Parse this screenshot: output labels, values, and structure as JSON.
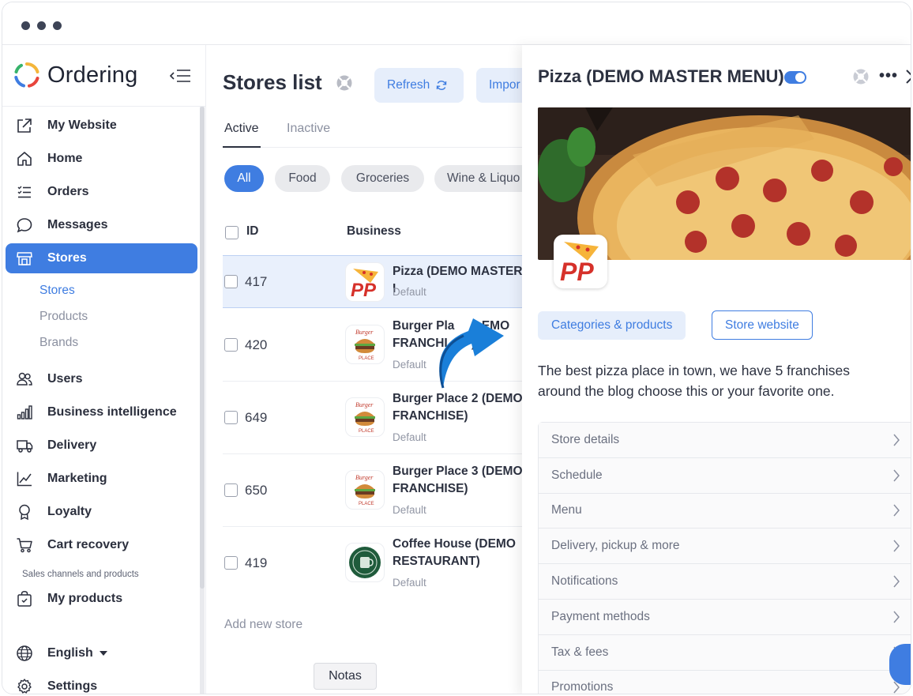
{
  "brand": {
    "name": "Ordering"
  },
  "sidebar": {
    "items": [
      {
        "label": "My Website",
        "icon": "external-link-icon"
      },
      {
        "label": "Home",
        "icon": "home-icon"
      },
      {
        "label": "Orders",
        "icon": "list-icon"
      },
      {
        "label": "Messages",
        "icon": "chat-icon"
      },
      {
        "label": "Stores",
        "icon": "store-icon",
        "active": true
      },
      {
        "label": "Users",
        "icon": "users-icon"
      },
      {
        "label": "Business intelligence",
        "icon": "bar-chart-icon"
      },
      {
        "label": "Delivery",
        "icon": "truck-icon"
      },
      {
        "label": "Marketing",
        "icon": "line-chart-icon"
      },
      {
        "label": "Loyalty",
        "icon": "award-icon"
      },
      {
        "label": "Cart recovery",
        "icon": "cart-icon"
      },
      {
        "label": "My products",
        "icon": "bag-icon"
      },
      {
        "label": "English",
        "icon": "globe-icon"
      },
      {
        "label": "Settings",
        "icon": "gear-icon"
      }
    ],
    "sub_items": [
      "Stores",
      "Products",
      "Brands"
    ],
    "section_caption": "Sales channels and products"
  },
  "main": {
    "title": "Stores list",
    "refresh_label": "Refresh",
    "import_label": "Impor",
    "tabs": [
      "Active",
      "Inactive"
    ],
    "chips": [
      "All",
      "Food",
      "Groceries",
      "Wine & Liquo"
    ],
    "columns": {
      "id": "ID",
      "business": "Business"
    },
    "rows": [
      {
        "id": "417",
        "name": "Pizza (DEMO MASTER I",
        "sub": "Default",
        "logo": "pizza-logo"
      },
      {
        "id": "420",
        "name": "Burger Pla        EMO\nFRANCHI       )",
        "sub": "Default",
        "logo": "burger-logo"
      },
      {
        "id": "649",
        "name": "Burger Place 2 (DEMO\nFRANCHISE)",
        "sub": "Default",
        "logo": "burger-logo"
      },
      {
        "id": "650",
        "name": "Burger Place 3 (DEMO\nFRANCHISE)",
        "sub": "Default",
        "logo": "burger-logo"
      },
      {
        "id": "419",
        "name": "Coffee House (DEMO\nRESTAURANT)",
        "sub": "Default",
        "logo": "coffee-logo"
      }
    ],
    "add_store_label": "Add new store",
    "tooltip": "Notas"
  },
  "drawer": {
    "title": "Pizza (DEMO MASTER MENU)",
    "enabled": true,
    "more_label": "•••",
    "buttons": {
      "categories": "Categories & products",
      "website": "Store website"
    },
    "description": "The best pizza place in town, we have 5 franchises around the blog choose this or your favorite one.",
    "menu": [
      "Store details",
      "Schedule",
      "Menu",
      "Delivery, pickup & more",
      "Notifications",
      "Payment methods",
      "Tax & fees",
      "Promotions"
    ]
  },
  "colors": {
    "accent": "#3f7de1",
    "accent_soft": "#e6eefb",
    "text": "#2c3140"
  }
}
